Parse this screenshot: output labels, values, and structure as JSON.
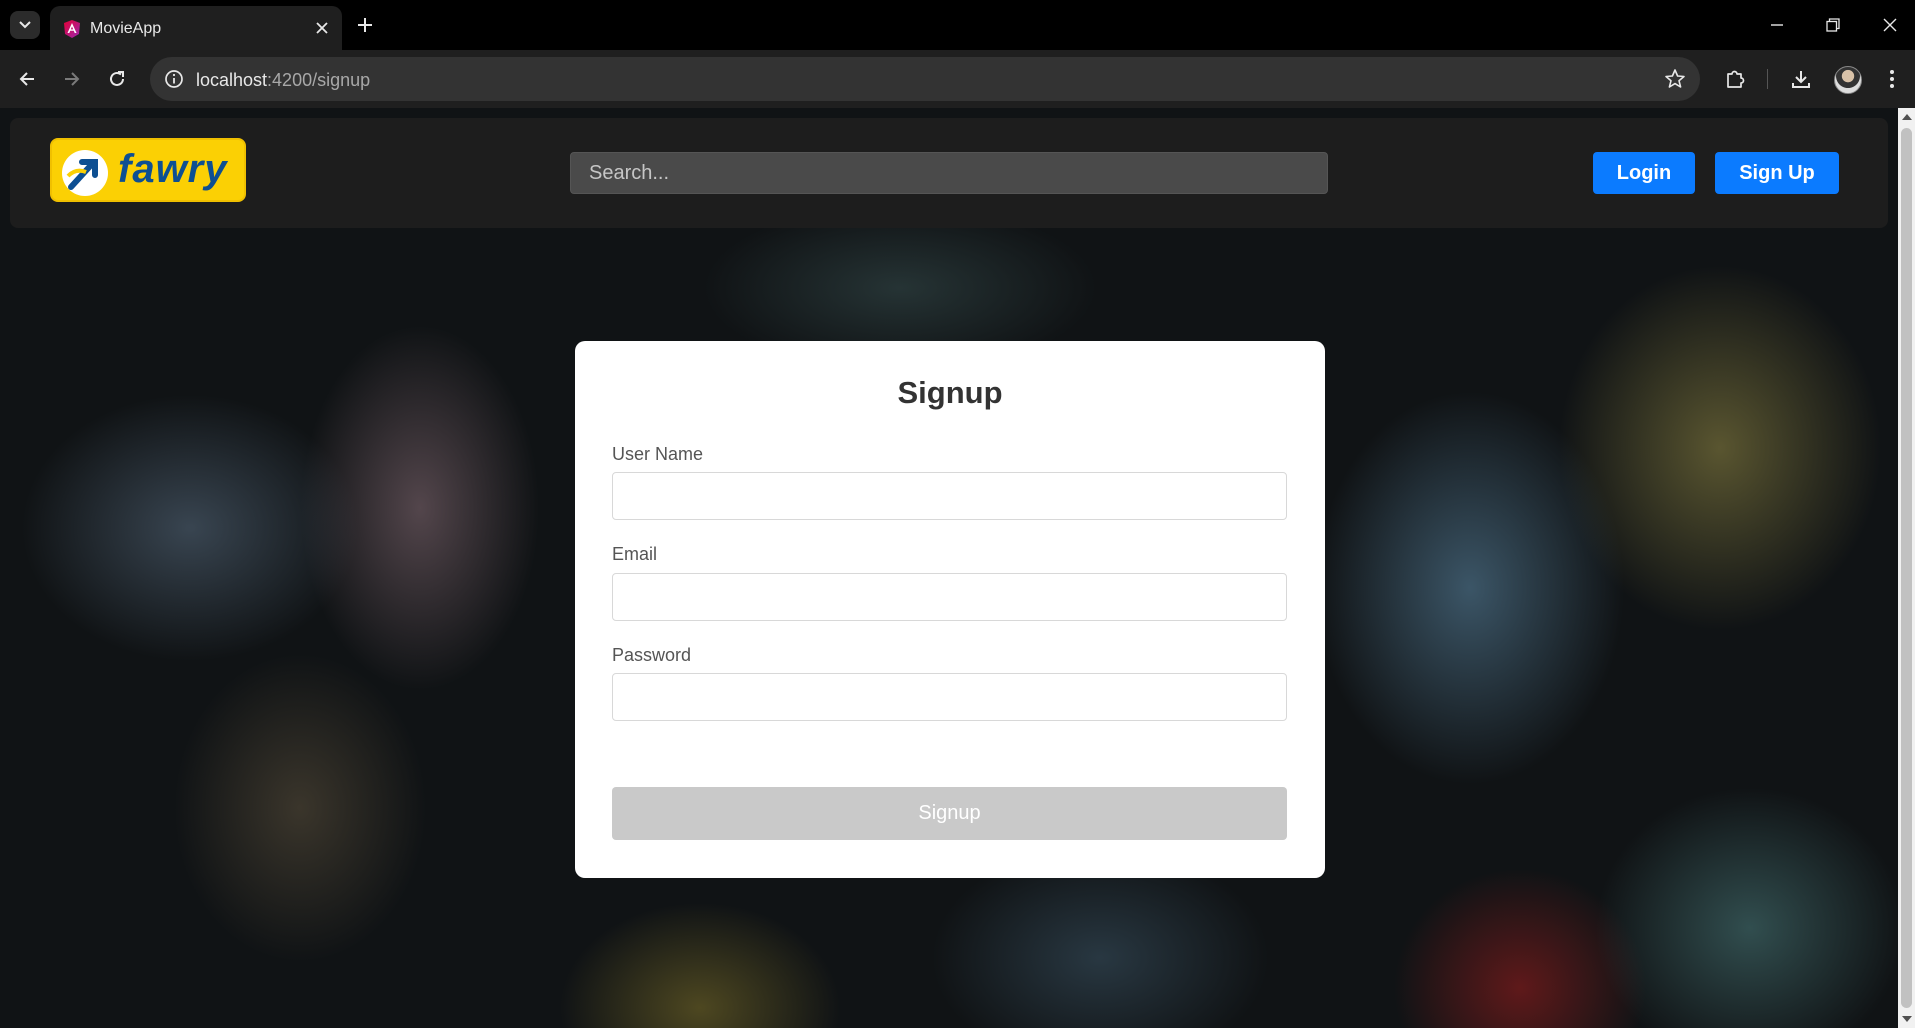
{
  "browser": {
    "tab_title": "MovieApp",
    "url_host": "localhost",
    "url_path": ":4200/signup"
  },
  "header": {
    "logo_text": "fawry",
    "search_placeholder": "Search...",
    "login_label": "Login",
    "signup_label": "Sign Up"
  },
  "form": {
    "title": "Signup",
    "username_label": "User Name",
    "username_value": "",
    "email_label": "Email",
    "email_value": "",
    "password_label": "Password",
    "password_value": "",
    "submit_label": "Signup"
  },
  "colors": {
    "primary_button": "#0b7bff",
    "logo_bg": "#fbd004",
    "logo_text": "#0d4f92",
    "disabled_button": "#c9c9c9"
  }
}
